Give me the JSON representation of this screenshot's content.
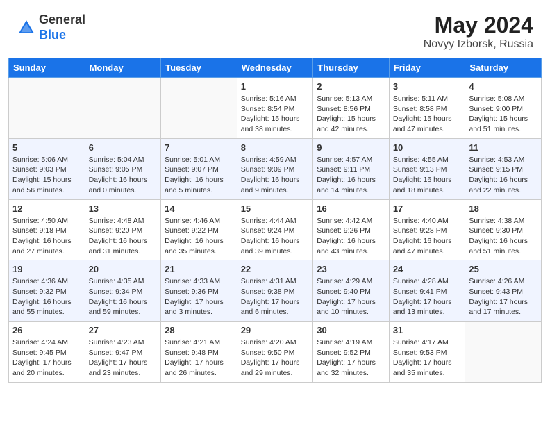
{
  "header": {
    "logo_general": "General",
    "logo_blue": "Blue",
    "month_year": "May 2024",
    "location": "Novyy Izborsk, Russia"
  },
  "weekdays": [
    "Sunday",
    "Monday",
    "Tuesday",
    "Wednesday",
    "Thursday",
    "Friday",
    "Saturday"
  ],
  "weeks": [
    [
      {
        "day": "",
        "info": ""
      },
      {
        "day": "",
        "info": ""
      },
      {
        "day": "",
        "info": ""
      },
      {
        "day": "1",
        "info": "Sunrise: 5:16 AM\nSunset: 8:54 PM\nDaylight: 15 hours\nand 38 minutes."
      },
      {
        "day": "2",
        "info": "Sunrise: 5:13 AM\nSunset: 8:56 PM\nDaylight: 15 hours\nand 42 minutes."
      },
      {
        "day": "3",
        "info": "Sunrise: 5:11 AM\nSunset: 8:58 PM\nDaylight: 15 hours\nand 47 minutes."
      },
      {
        "day": "4",
        "info": "Sunrise: 5:08 AM\nSunset: 9:00 PM\nDaylight: 15 hours\nand 51 minutes."
      }
    ],
    [
      {
        "day": "5",
        "info": "Sunrise: 5:06 AM\nSunset: 9:03 PM\nDaylight: 15 hours\nand 56 minutes."
      },
      {
        "day": "6",
        "info": "Sunrise: 5:04 AM\nSunset: 9:05 PM\nDaylight: 16 hours\nand 0 minutes."
      },
      {
        "day": "7",
        "info": "Sunrise: 5:01 AM\nSunset: 9:07 PM\nDaylight: 16 hours\nand 5 minutes."
      },
      {
        "day": "8",
        "info": "Sunrise: 4:59 AM\nSunset: 9:09 PM\nDaylight: 16 hours\nand 9 minutes."
      },
      {
        "day": "9",
        "info": "Sunrise: 4:57 AM\nSunset: 9:11 PM\nDaylight: 16 hours\nand 14 minutes."
      },
      {
        "day": "10",
        "info": "Sunrise: 4:55 AM\nSunset: 9:13 PM\nDaylight: 16 hours\nand 18 minutes."
      },
      {
        "day": "11",
        "info": "Sunrise: 4:53 AM\nSunset: 9:15 PM\nDaylight: 16 hours\nand 22 minutes."
      }
    ],
    [
      {
        "day": "12",
        "info": "Sunrise: 4:50 AM\nSunset: 9:18 PM\nDaylight: 16 hours\nand 27 minutes."
      },
      {
        "day": "13",
        "info": "Sunrise: 4:48 AM\nSunset: 9:20 PM\nDaylight: 16 hours\nand 31 minutes."
      },
      {
        "day": "14",
        "info": "Sunrise: 4:46 AM\nSunset: 9:22 PM\nDaylight: 16 hours\nand 35 minutes."
      },
      {
        "day": "15",
        "info": "Sunrise: 4:44 AM\nSunset: 9:24 PM\nDaylight: 16 hours\nand 39 minutes."
      },
      {
        "day": "16",
        "info": "Sunrise: 4:42 AM\nSunset: 9:26 PM\nDaylight: 16 hours\nand 43 minutes."
      },
      {
        "day": "17",
        "info": "Sunrise: 4:40 AM\nSunset: 9:28 PM\nDaylight: 16 hours\nand 47 minutes."
      },
      {
        "day": "18",
        "info": "Sunrise: 4:38 AM\nSunset: 9:30 PM\nDaylight: 16 hours\nand 51 minutes."
      }
    ],
    [
      {
        "day": "19",
        "info": "Sunrise: 4:36 AM\nSunset: 9:32 PM\nDaylight: 16 hours\nand 55 minutes."
      },
      {
        "day": "20",
        "info": "Sunrise: 4:35 AM\nSunset: 9:34 PM\nDaylight: 16 hours\nand 59 minutes."
      },
      {
        "day": "21",
        "info": "Sunrise: 4:33 AM\nSunset: 9:36 PM\nDaylight: 17 hours\nand 3 minutes."
      },
      {
        "day": "22",
        "info": "Sunrise: 4:31 AM\nSunset: 9:38 PM\nDaylight: 17 hours\nand 6 minutes."
      },
      {
        "day": "23",
        "info": "Sunrise: 4:29 AM\nSunset: 9:40 PM\nDaylight: 17 hours\nand 10 minutes."
      },
      {
        "day": "24",
        "info": "Sunrise: 4:28 AM\nSunset: 9:41 PM\nDaylight: 17 hours\nand 13 minutes."
      },
      {
        "day": "25",
        "info": "Sunrise: 4:26 AM\nSunset: 9:43 PM\nDaylight: 17 hours\nand 17 minutes."
      }
    ],
    [
      {
        "day": "26",
        "info": "Sunrise: 4:24 AM\nSunset: 9:45 PM\nDaylight: 17 hours\nand 20 minutes."
      },
      {
        "day": "27",
        "info": "Sunrise: 4:23 AM\nSunset: 9:47 PM\nDaylight: 17 hours\nand 23 minutes."
      },
      {
        "day": "28",
        "info": "Sunrise: 4:21 AM\nSunset: 9:48 PM\nDaylight: 17 hours\nand 26 minutes."
      },
      {
        "day": "29",
        "info": "Sunrise: 4:20 AM\nSunset: 9:50 PM\nDaylight: 17 hours\nand 29 minutes."
      },
      {
        "day": "30",
        "info": "Sunrise: 4:19 AM\nSunset: 9:52 PM\nDaylight: 17 hours\nand 32 minutes."
      },
      {
        "day": "31",
        "info": "Sunrise: 4:17 AM\nSunset: 9:53 PM\nDaylight: 17 hours\nand 35 minutes."
      },
      {
        "day": "",
        "info": ""
      }
    ]
  ]
}
